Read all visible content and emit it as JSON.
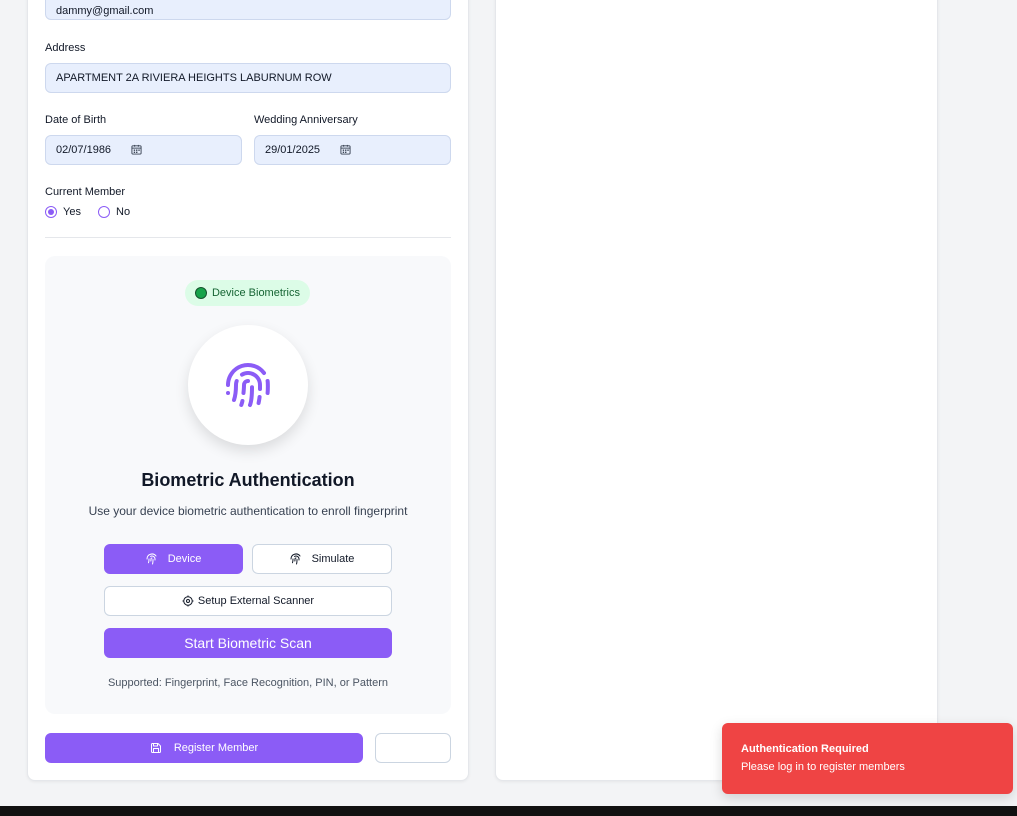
{
  "form": {
    "email_value": "dammy@gmail.com",
    "address_label": "Address",
    "address_value": "APARTMENT 2A RIVIERA HEIGHTS LABURNUM ROW",
    "dob_label": "Date of Birth",
    "dob_value": "02/07/1986",
    "anniversary_label": "Wedding Anniversary",
    "anniversary_value": "29/01/2025",
    "current_member_label": "Current Member",
    "current_member_options": [
      "Yes",
      "No"
    ],
    "current_member_selected": "Yes"
  },
  "biometric": {
    "badge_label": "Device Biometrics",
    "title": "Biometric Authentication",
    "subtitle": "Use your device biometric authentication to enroll fingerprint",
    "device_button": "Device",
    "simulate_button": "Simulate",
    "external_scanner_button": "Setup External Scanner",
    "start_scan_button": "Start Biometric Scan",
    "supported_text": "Supported: Fingerprint, Face Recognition, PIN, or Pattern"
  },
  "actions": {
    "register_button": "Register Member",
    "secondary_button": ""
  },
  "toast": {
    "title": "Authentication Required",
    "message": "Please log in to register members"
  },
  "colors": {
    "accent": "#8b5cf6",
    "input_bg": "#e8effd",
    "toast_bg": "#ef4444",
    "badge_bg": "#dcfce7",
    "badge_dot": "#16a34a"
  }
}
